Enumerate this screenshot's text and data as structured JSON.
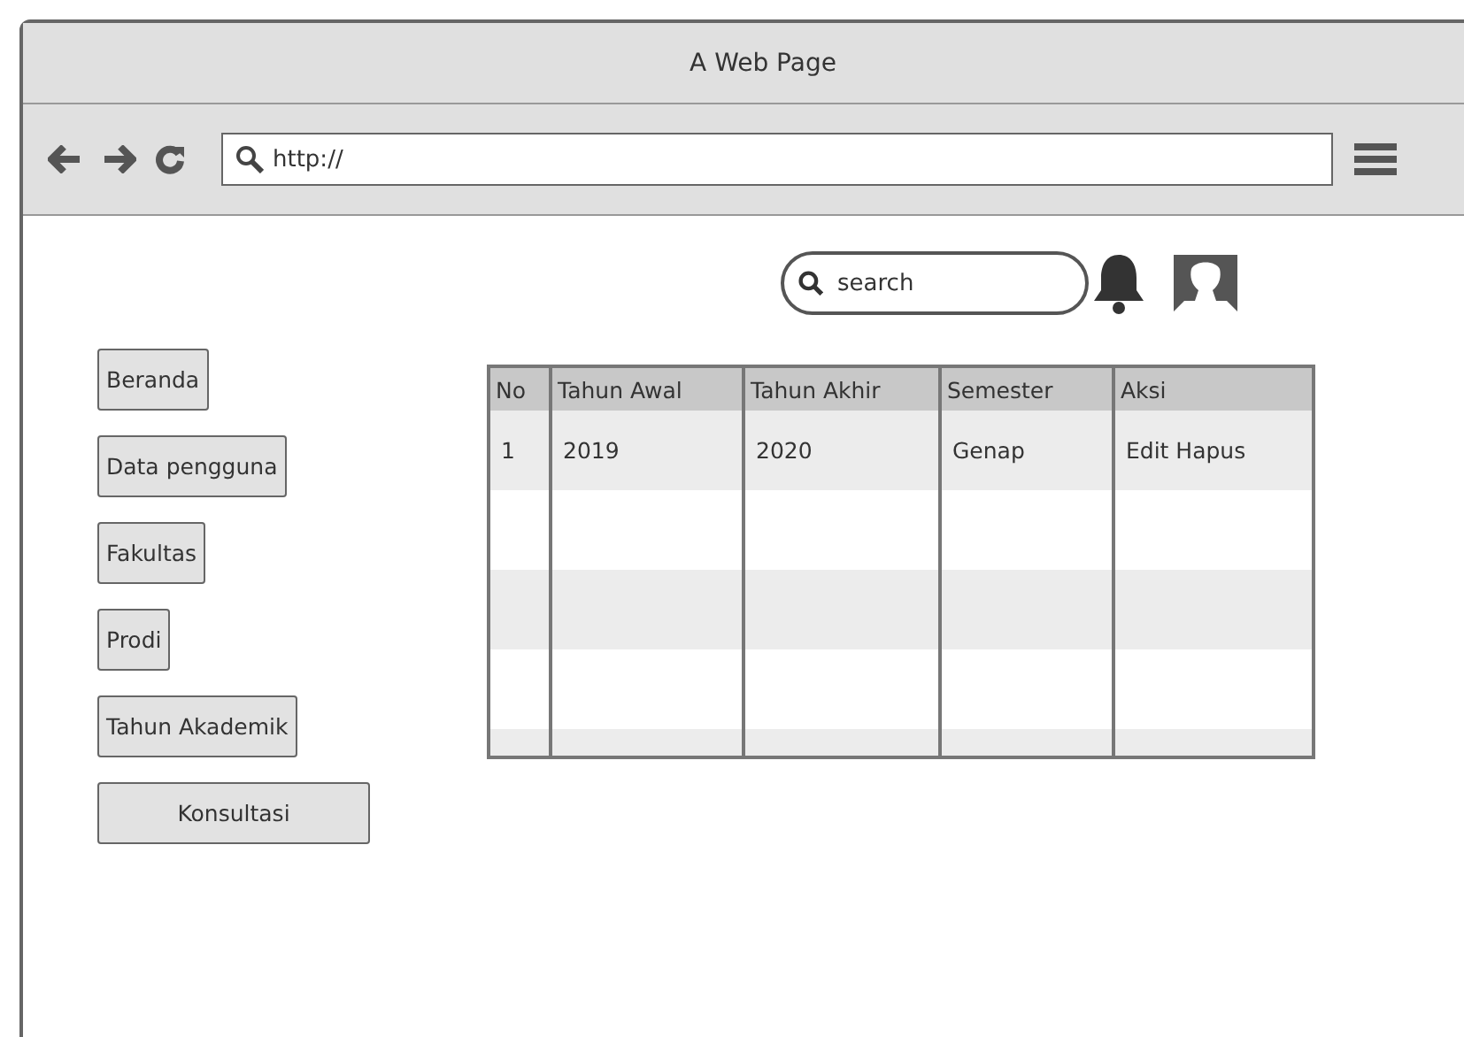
{
  "window": {
    "title": "A Web Page"
  },
  "address_bar": {
    "value": "http://"
  },
  "search": {
    "placeholder": "search"
  },
  "sidebar": {
    "items": [
      {
        "label": "Beranda"
      },
      {
        "label": "Data pengguna"
      },
      {
        "label": "Fakultas"
      },
      {
        "label": "Prodi"
      },
      {
        "label": "Tahun Akademik"
      },
      {
        "label": "Konsultasi"
      }
    ]
  },
  "table": {
    "columns": [
      "No",
      "Tahun Awal",
      "Tahun Akhir",
      "Semester",
      "Aksi"
    ],
    "rows": [
      [
        "1",
        "2019",
        "2020",
        "Genap",
        "Edit Hapus"
      ]
    ]
  }
}
